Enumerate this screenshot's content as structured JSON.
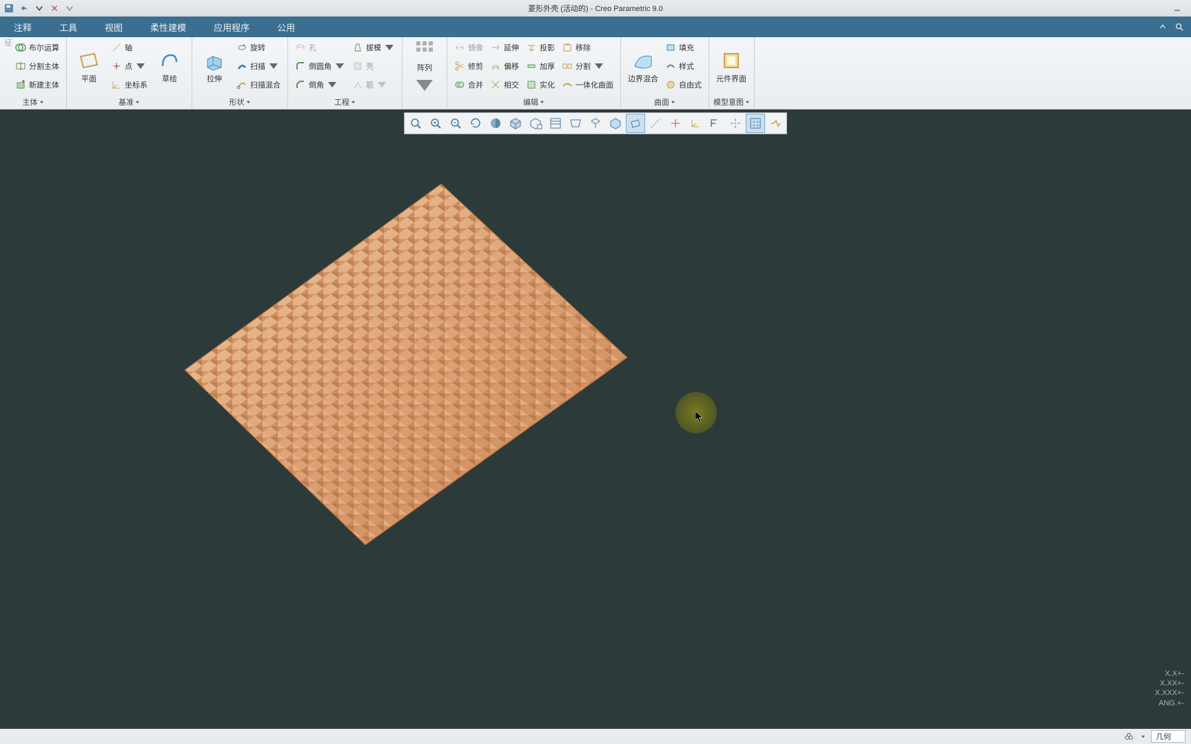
{
  "title": "菱形外壳 (活动的) - Creo Parametric 9.0",
  "menu_tabs": [
    "注释",
    "工具",
    "视图",
    "柔性建模",
    "应用程序",
    "公用"
  ],
  "ribbon": {
    "g_body": {
      "label": "主体",
      "boolean": "布尔运算",
      "split": "分割主体",
      "new": "新建主体"
    },
    "g_datum": {
      "label": "基准",
      "plane": "平面",
      "sketch": "草绘",
      "axis": "轴",
      "point": "点",
      "csys": "坐标系"
    },
    "g_shape": {
      "label": "形状",
      "extrude": "拉伸",
      "revolve": "旋转",
      "sweep": "扫描",
      "sweep_blend": "扫描混合"
    },
    "g_eng": {
      "label": "工程",
      "hole": "孔",
      "round": "倒圆角",
      "chamfer": "倒角",
      "draft": "拔模",
      "shell": "壳",
      "rib": "筋"
    },
    "g_pattern": {
      "label": "阵列"
    },
    "g_edit": {
      "label": "编辑",
      "mirror": "镜像",
      "trim": "修剪",
      "merge": "合并",
      "extend": "延伸",
      "offset": "偏移",
      "intersect": "相交",
      "project": "投影",
      "thicken": "加厚",
      "solidify": "实化",
      "remove": "移除",
      "split": "分割",
      "curve": "一体化曲面"
    },
    "g_surf": {
      "label": "曲面",
      "blend": "边界混合",
      "fill": "填充",
      "style": "样式",
      "free": "自由式"
    },
    "g_intent": {
      "label": "模型意图",
      "comp": "元件界面"
    }
  },
  "status": {
    "combo": "几何"
  },
  "hud": {
    "l1": "X.X+-",
    "l2": "X.XX+-",
    "l3": "X.XXX+-",
    "l4": "ANG.+-"
  }
}
